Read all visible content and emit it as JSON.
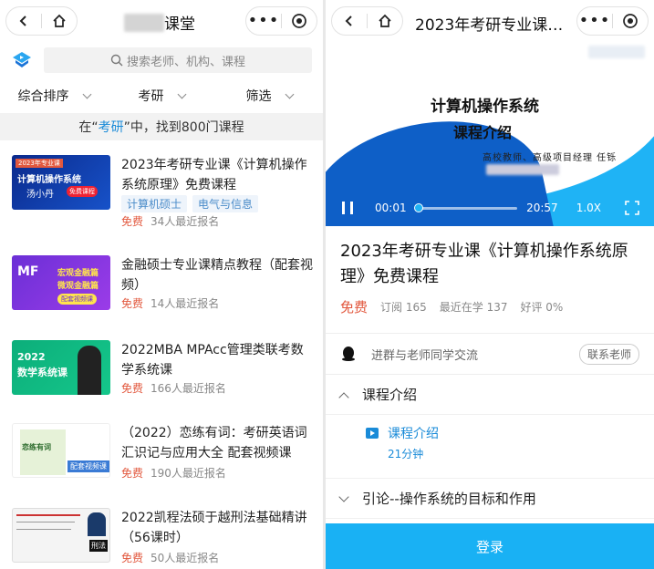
{
  "left": {
    "title_suffix": "课堂",
    "search_placeholder": "搜索老师、机构、课程",
    "filters": [
      "综合排序",
      "考研",
      "筛选"
    ],
    "banner": {
      "prefix": "在“",
      "keyword": "考研",
      "suffix": "”中，找到800门课程"
    },
    "courses": [
      {
        "title": "2023年考研专业课《计算机操作系统原理》免费课程",
        "tags": [
          "计算机硕士",
          "电气与信息"
        ],
        "price": "免费",
        "enrolled": "34人最近报名",
        "thumb": {
          "top": "2023年专业课",
          "line1": "计算机操作系统",
          "name": "汤小丹",
          "badge": "免费课程"
        }
      },
      {
        "title": "金融硕士专业课精点教程（配套视频）",
        "tags": [],
        "price": "免费",
        "enrolled": "14人最近报名",
        "thumb": {
          "line1": "MF",
          "line2": "宏观金融篇",
          "line3": "微观金融篇",
          "badge": "配套视频课"
        }
      },
      {
        "title": "2022MBA MPAcc管理类联考数学系统课",
        "tags": [],
        "price": "免费",
        "enrolled": "166人最近报名",
        "thumb": {
          "line1": "2022",
          "line2": "数学系统课"
        }
      },
      {
        "title": "（2022）恋练有词：考研英语词汇识记与应用大全 配套视频课",
        "tags": [],
        "price": "免费",
        "enrolled": "190人最近报名",
        "thumb": {
          "line1": "恋练有词",
          "badge": "配套视频课"
        }
      },
      {
        "title": "2022凯程法硕于越刑法基础精讲（56课时）",
        "tags": [],
        "price": "免费",
        "enrolled": "50人最近报名",
        "thumb": {
          "badge": "刑法"
        }
      }
    ]
  },
  "right": {
    "title": "2023年考研专业课…",
    "video": {
      "title1": "计算机操作系统",
      "title2": "课程介绍",
      "subtitle": "高校教师、高级项目经理  任铄",
      "time_current": "00:01",
      "time_total": "20:57",
      "speed": "1.0X",
      "progress": 0.0
    },
    "course_title": "2023年考研专业课《计算机操作系统原理》免费课程",
    "price": "免费",
    "subscribe": "订阅 165",
    "recent": "最近在学 137",
    "rating": "好评 0%",
    "group_text": "进群与老师同学交流",
    "contact_button": "联系老师",
    "chapters": [
      {
        "title": "课程介绍",
        "expanded": true,
        "lessons": [
          {
            "title": "课程介绍",
            "duration": "21分钟"
          }
        ]
      },
      {
        "title": "引论--操作系统的目标和作用",
        "expanded": false,
        "lessons": []
      }
    ],
    "login_button": "登录"
  },
  "colors": {
    "accent": "#19b1f4",
    "price": "#e2583e",
    "link": "#1a8bd8"
  }
}
